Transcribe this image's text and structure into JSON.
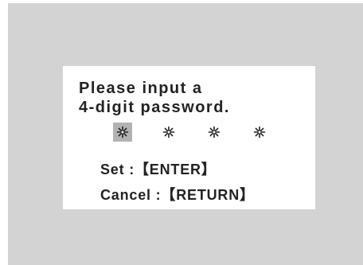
{
  "dialog": {
    "prompt_line1": "Please input a",
    "prompt_line2": "4-digit password.",
    "pin_slots": [
      {
        "icon": "asterisk-icon",
        "active": true
      },
      {
        "icon": "asterisk-icon",
        "active": false
      },
      {
        "icon": "asterisk-icon",
        "active": false
      },
      {
        "icon": "asterisk-icon",
        "active": false
      }
    ],
    "set_hint": "Set :【ENTER】",
    "cancel_hint": "Cancel :【RETURN】"
  },
  "colors": {
    "screen_background": "#d3d3d3",
    "dialog_background": "#ffffff",
    "text": "#222222",
    "active_slot_highlight": "#b3b3b3"
  }
}
